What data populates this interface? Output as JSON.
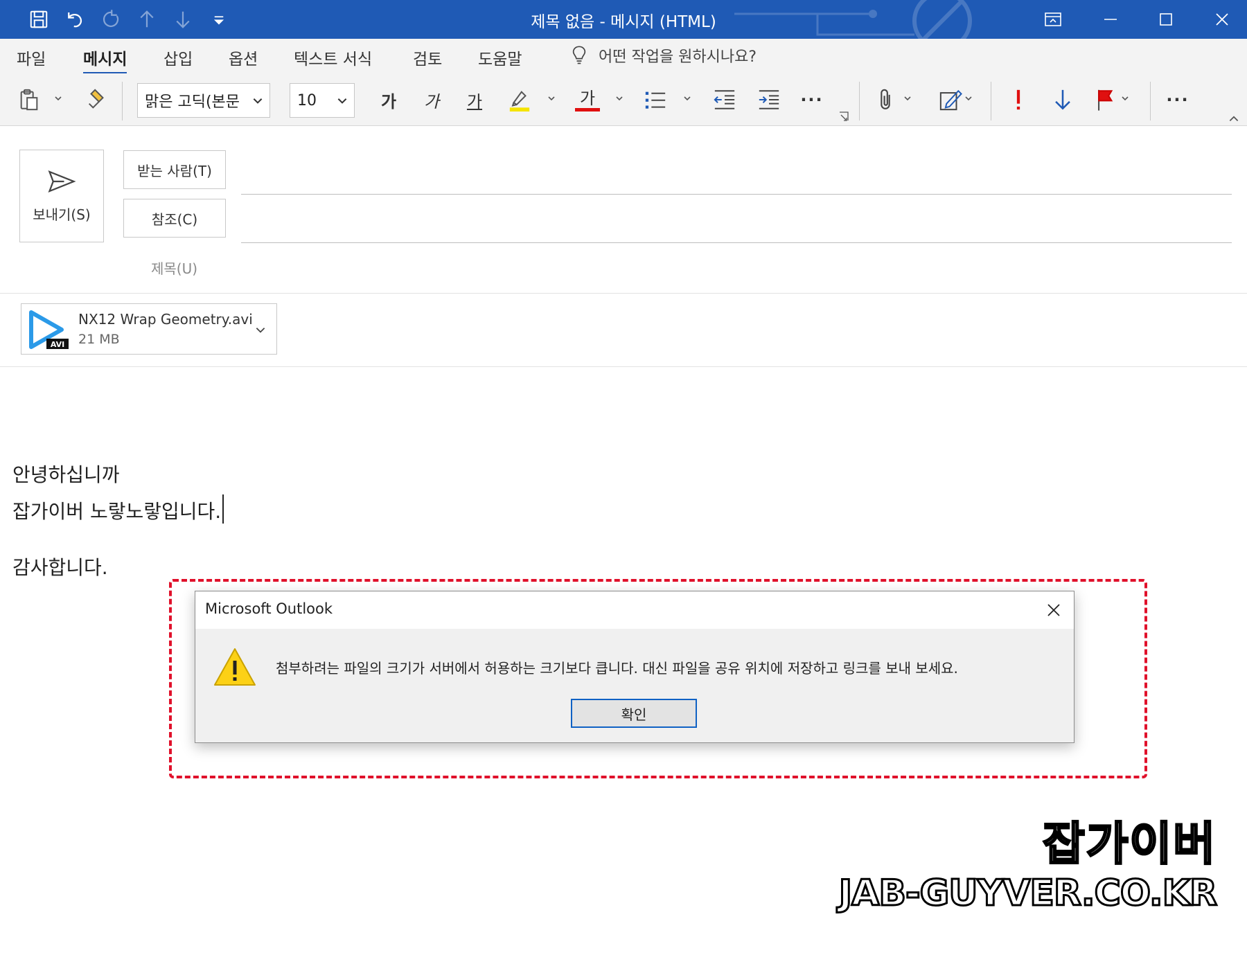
{
  "window": {
    "title": "제목 없음  -  메시지 (HTML)"
  },
  "menu": {
    "tabs": [
      "파일",
      "메시지",
      "삽입",
      "옵션",
      "텍스트 서식",
      "검토",
      "도움말"
    ],
    "active_tab": "메시지",
    "tell_me": "어떤 작업을 원하시나요?"
  },
  "ribbon": {
    "font_name": "맑은 고딕(본문",
    "font_size": "10",
    "bold": "가",
    "italic": "가",
    "underline": "가",
    "font_color_glyph": "가",
    "more": "···",
    "highlight_color": "#f5e400",
    "font_color": "#e01010"
  },
  "compose": {
    "send_label": "보내기(S)",
    "to_label": "받는 사람(T)",
    "cc_label": "참조(C)",
    "subject_label": "제목(U)"
  },
  "attachment": {
    "name": "NX12 Wrap Geometry.avi",
    "size": "21 MB",
    "badge": "AVI"
  },
  "body": {
    "line1": "안녕하십니까",
    "line2": "잡가이버 노랗노랗입니다.",
    "line3": "감사합니다."
  },
  "dialog": {
    "title": "Microsoft Outlook",
    "message": "첨부하려는 파일의 크기가 서버에서 허용하는 크기보다 큽니다. 대신 파일을 공유 위치에 저장하고 링크를 보내 보세요.",
    "ok_label": "확인"
  },
  "watermark": {
    "korean": "잡가이버",
    "url": "JAB-GUYVER.CO.KR"
  },
  "colors": {
    "titlebar": "#1f5ab5",
    "highlight_border": "#e0112b",
    "dialog_button_border": "#0f61c4"
  }
}
